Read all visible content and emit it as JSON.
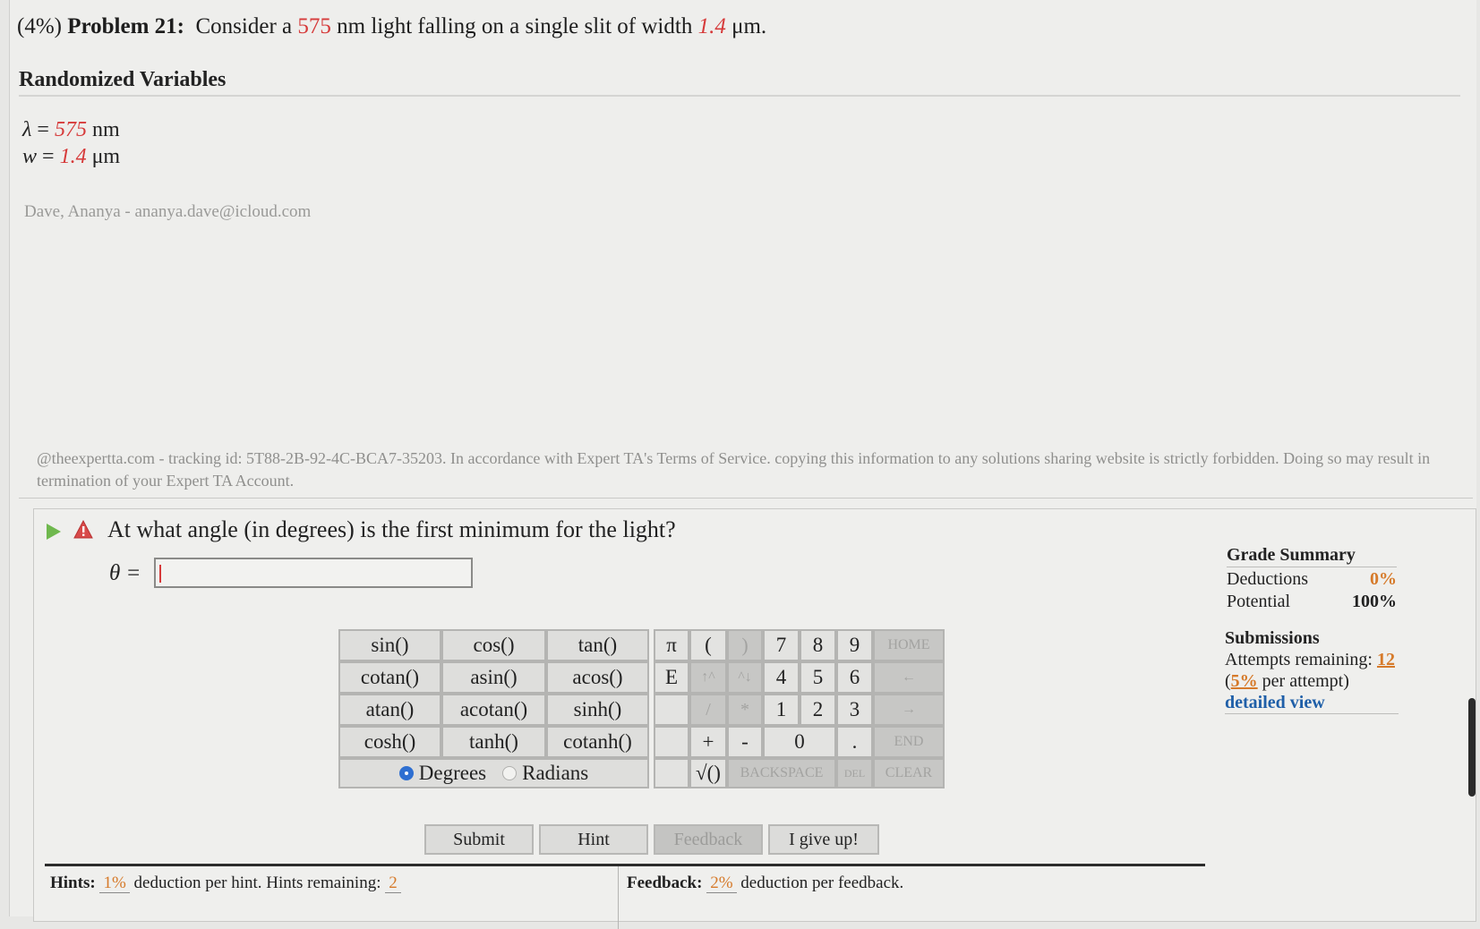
{
  "problem": {
    "weight": "(4%)",
    "label": "Problem 21:",
    "text_before": "Consider a",
    "wavelength": "575",
    "text_mid": "nm light falling on a single slit of width",
    "width": "1.4",
    "text_after": "μm."
  },
  "variables": {
    "title": "Randomized Variables",
    "lambda_symbol": "λ",
    "lambda_value": "575",
    "lambda_unit": "nm",
    "w_symbol": "w",
    "w_value": "1.4",
    "w_unit": "μm",
    "equals": "="
  },
  "student_line": "Dave, Ananya - ananya.dave@icloud.com",
  "tracking_text": "@theexpertta.com - tracking id: 5T88-2B-92-4C-BCA7-35203. In accordance with Expert TA's Terms of Service. copying this information to any solutions sharing website is strictly forbidden. Doing so may result in termination of your Expert TA Account.",
  "question": {
    "text": "At what angle (in degrees) is the first minimum for the light?",
    "var_label": "θ =",
    "answer_value": ""
  },
  "grade_summary": {
    "title": "Grade Summary",
    "deductions_label": "Deductions",
    "deductions_value": "0%",
    "potential_label": "Potential",
    "potential_value": "100%"
  },
  "submissions": {
    "title": "Submissions",
    "attempts_label": "Attempts remaining:",
    "attempts_value": "12",
    "per_attempt_open": "(",
    "per_attempt_value": "5%",
    "per_attempt_close": "per attempt)",
    "detailed_link": "detailed view"
  },
  "keypad": {
    "functions": [
      "sin()",
      "cos()",
      "tan()",
      "cotan()",
      "asin()",
      "acos()",
      "atan()",
      "acotan()",
      "sinh()",
      "cosh()",
      "tanh()",
      "cotanh()"
    ],
    "pi": "π",
    "e": "E",
    "open_paren": "(",
    "close_paren": ")",
    "up": "↑^",
    "down": "^↓",
    "divide": "/",
    "multiply": "*",
    "plus": "+",
    "minus": "-",
    "sqrt": "√()",
    "digits": [
      "7",
      "8",
      "9",
      "4",
      "5",
      "6",
      "1",
      "2",
      "3",
      "0"
    ],
    "dot": ".",
    "home": "HOME",
    "left": "←",
    "right": "→",
    "end": "END",
    "backspace": "BACKSPACE",
    "del": "DEL",
    "clear": "CLEAR",
    "degrees": "Degrees",
    "radians": "Radians"
  },
  "buttons": {
    "submit": "Submit",
    "hint": "Hint",
    "feedback": "Feedback",
    "give_up": "I give up!"
  },
  "hints": {
    "label": "Hints:",
    "pct": "1%",
    "text": "deduction per hint. Hints remaining:",
    "remaining": "2"
  },
  "feedback": {
    "label": "Feedback:",
    "pct": "2%",
    "text": "deduction per feedback."
  },
  "colors": {
    "accent_red": "#d63a3a",
    "accent_orange": "#d67a2a",
    "link_blue": "#1f5fa8",
    "radio_blue": "#2e6fd1"
  }
}
